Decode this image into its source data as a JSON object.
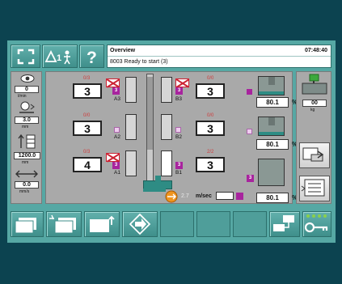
{
  "header": {
    "screen_title": "Overview",
    "status_message": "8003 Ready to start (3)",
    "clock": "07:48:40"
  },
  "left_panel": {
    "v1": "0",
    "u1": "l/min",
    "v2": "3.0",
    "u2": "mm",
    "v3": "1200.0",
    "u3": "mm",
    "v4": "0.0",
    "u4": "mm/s"
  },
  "stations": {
    "a3": {
      "label": "A3",
      "fraction": "0/3",
      "value": "3",
      "badge": "3"
    },
    "a2": {
      "label": "A2",
      "fraction": "0/0",
      "value": "3"
    },
    "a1": {
      "label": "A1",
      "fraction": "0/3",
      "value": "4",
      "badge": "3"
    },
    "b3": {
      "label": "B3",
      "fraction": "0/0",
      "value": "3",
      "badge": "3"
    },
    "b2": {
      "label": "B2",
      "fraction": "0/0",
      "value": "3"
    },
    "b1": {
      "label": "B1",
      "fraction": "2/2",
      "value": "3",
      "badge": "3"
    }
  },
  "speed": {
    "value": "2.7",
    "unit": "m/sec"
  },
  "molds": [
    {
      "percent": "80.1",
      "unit": "%",
      "badge": "5"
    },
    {
      "percent": "80.1",
      "unit": "%"
    },
    {
      "percent": "80.1",
      "unit": "%",
      "badge": "3"
    }
  ],
  "right_panel": {
    "counter": "00",
    "counter_unit": "kg"
  }
}
